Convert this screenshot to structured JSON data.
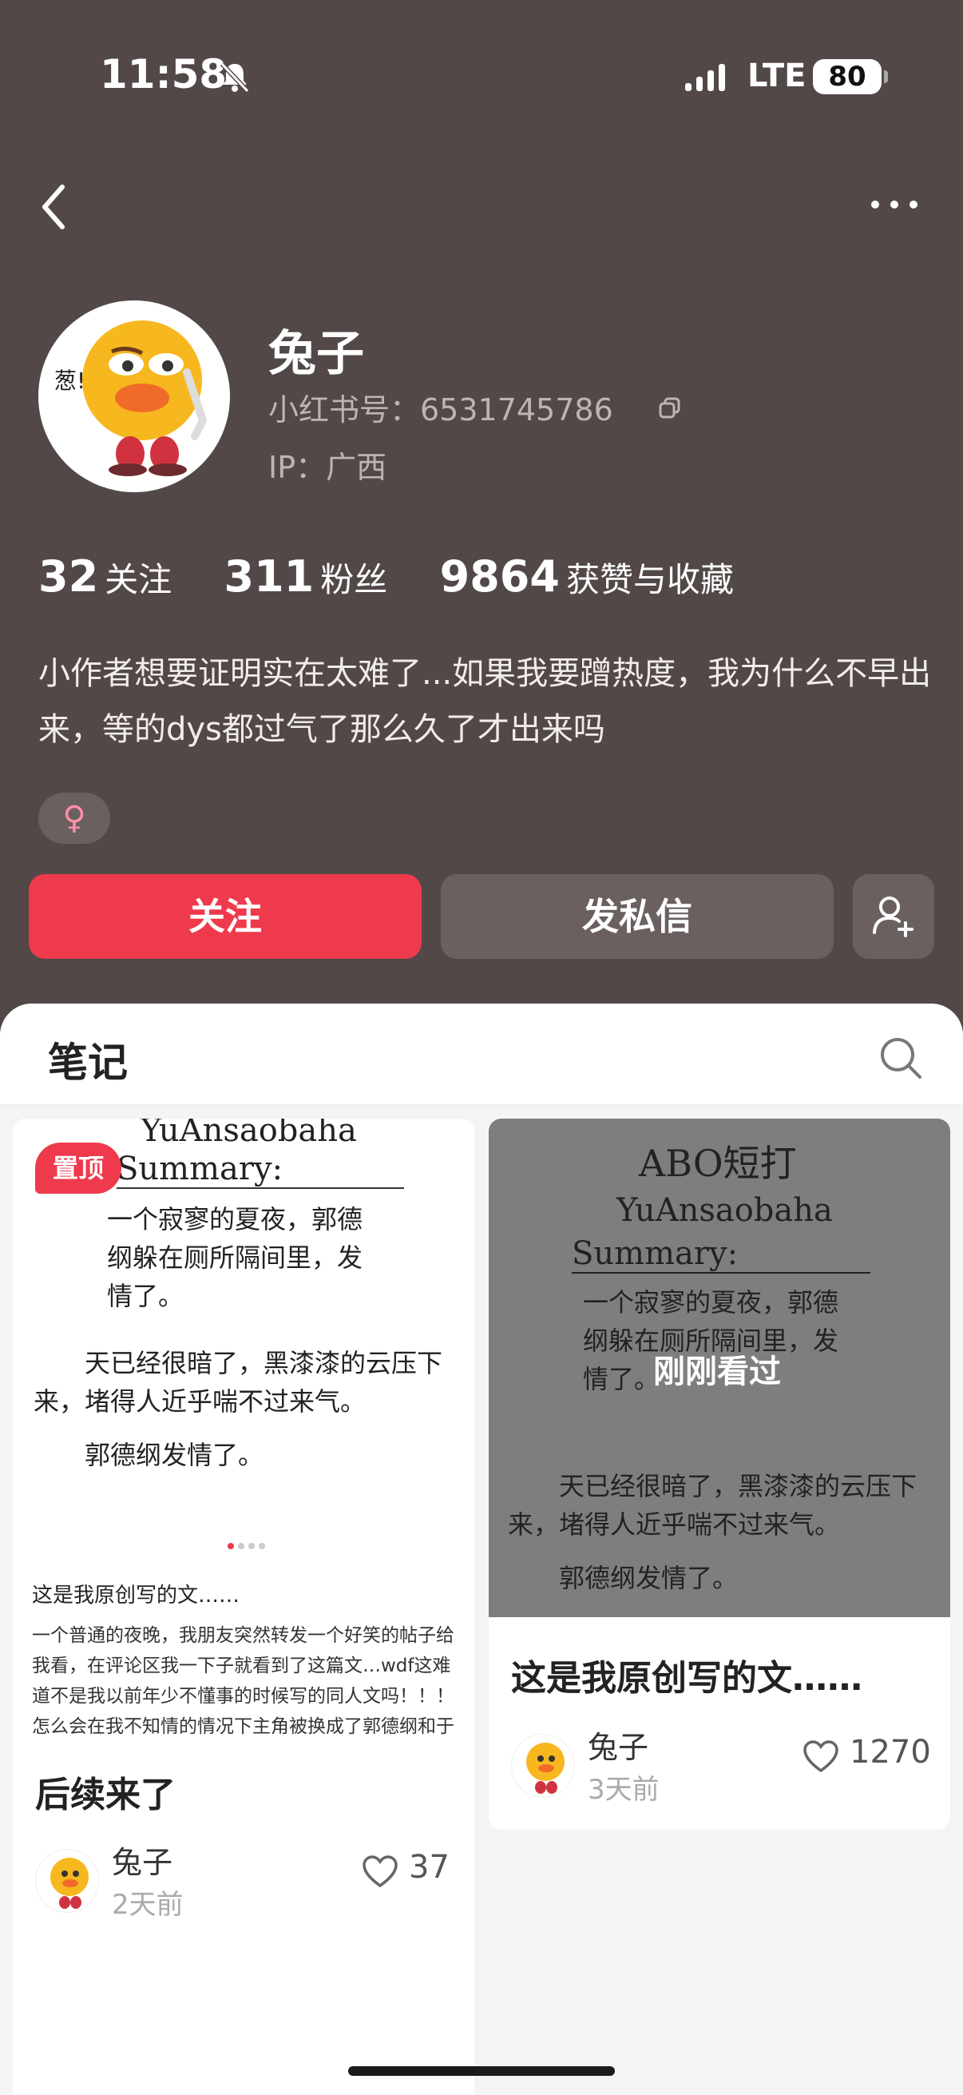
{
  "status_bar": {
    "time": "11:58",
    "network": "LTE",
    "battery": "80"
  },
  "profile": {
    "nickname": "兔子",
    "redbook_id": "小红书号：6531745786",
    "ip": "IP：广西",
    "stats": [
      {
        "value": "32",
        "label": "关注"
      },
      {
        "value": "311",
        "label": "粉丝"
      },
      {
        "value": "9864",
        "label": "获赞与收藏"
      }
    ],
    "bio": "小作者想要证明实在太难了...如果我要蹭热度，我为什么不早出来，等的dys都过气了那么久了才出来吗",
    "gender_symbol": "♀",
    "avatar_text": "葱!"
  },
  "actions": {
    "follow": "关注",
    "message": "发私信"
  },
  "tabs": {
    "notes": "笔记"
  },
  "notes": [
    {
      "pinned_label": "置顶",
      "cover": {
        "author": "YuAnsaobaha",
        "summary": "Summary:",
        "para1": "一个寂寥的夏夜，郭德纲躲在厕所隔间里，发情了。",
        "para2": "天已经很暗了，黑漆漆的云压下来，堵得人近乎喘不过来气。",
        "para3": "郭德纲发情了。",
        "note_title": "这是我原创写的文……",
        "note_body": "一个普通的夜晚，我朋友突然转发一个好笑的帖子给我看，在评论区我一下子就看到了这篇文…wdf这难道不是我以前年少不懂事的时候写的同人文吗！！！怎么会在我不知情的情况下主角被换成了郭德纲和于谦在这个帖子出现啊啊啊啊啊啊啊"
      },
      "title": "后续来了",
      "author": "兔子",
      "time": "2天前",
      "likes": "37"
    },
    {
      "cover": {
        "title": "ABO短打",
        "author": "YuAnsaobaha",
        "summary": "Summary:",
        "para1": "一个寂寥的夏夜，郭德纲躲在厕所隔间里，发情了。",
        "para2": "天已经很暗了，黑漆漆的云压下来，堵得人近乎喘不过来气。",
        "para3": "郭德纲发情了。",
        "overlay": "刚刚看过"
      },
      "title": "这是我原创写的文……",
      "author": "兔子",
      "time": "3天前",
      "likes": "1270"
    }
  ],
  "colors": {
    "profile_bg": "#524847",
    "accent": "#ee3a4c"
  }
}
